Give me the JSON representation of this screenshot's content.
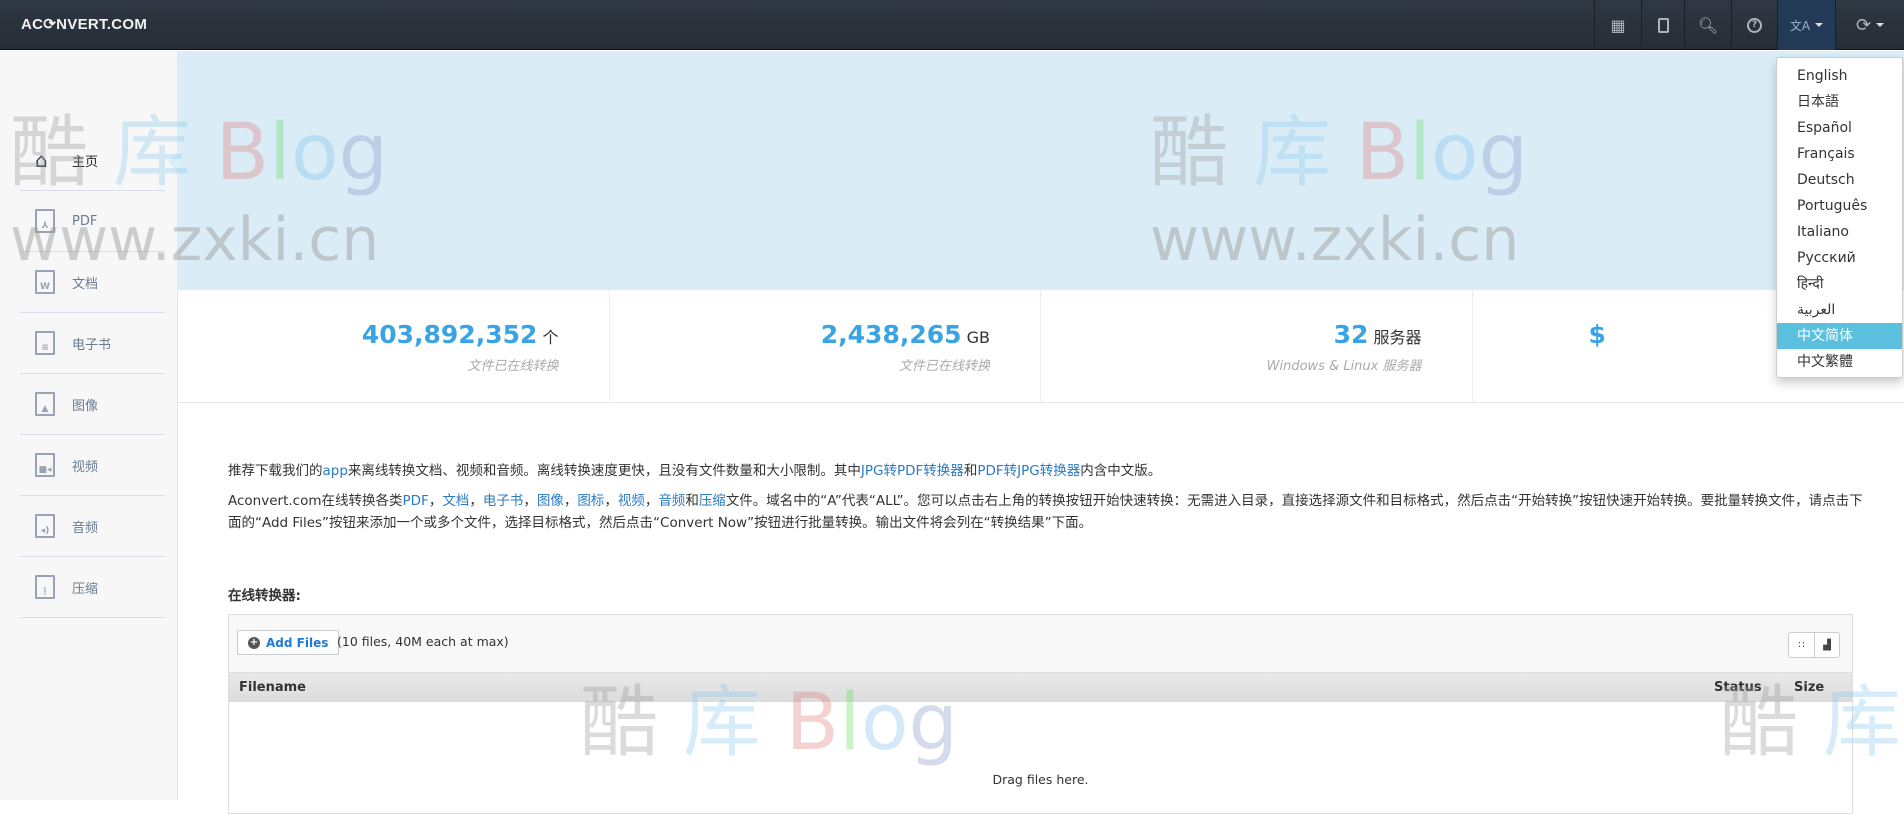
{
  "navbar": {
    "logo": "AC⟳NVERT.COM",
    "buttons": [
      {
        "icon": "grid-icon"
      },
      {
        "icon": "tablet-icon"
      },
      {
        "icon": "search-icon"
      },
      {
        "icon": "help-icon"
      },
      {
        "icon": "language-icon"
      },
      {
        "icon": "refresh-icon"
      }
    ]
  },
  "sidebar": {
    "items": [
      {
        "label": "主页",
        "icon": "home-icon"
      },
      {
        "label": "PDF",
        "icon": "pdf-file-icon"
      },
      {
        "label": "文档",
        "icon": "word-file-icon"
      },
      {
        "label": "电子书",
        "icon": "ebook-file-icon"
      },
      {
        "label": "图像",
        "icon": "image-file-icon"
      },
      {
        "label": "视频",
        "icon": "video-file-icon"
      },
      {
        "label": "音频",
        "icon": "audio-file-icon"
      },
      {
        "label": "压缩",
        "icon": "archive-file-icon"
      }
    ]
  },
  "stats": [
    {
      "value": "403,892,352",
      "unit": "个",
      "sub": "文件已在线转换"
    },
    {
      "value": "2,438,265",
      "unit": "GB",
      "sub": "文件已在线转换"
    },
    {
      "value": "32",
      "unit": "服务器",
      "sub": "Windows & Linux 服务器"
    },
    {
      "value": "$",
      "unit": "",
      "sub": ""
    }
  ],
  "intro": {
    "p1": [
      "推荐下载我们的",
      "app",
      "来离线转换文档、视频和音频。离线转换速度更快，且没有文件数量和大小限制。其中",
      "JPG转PDF转换器",
      "和",
      "PDF转JPG转换器",
      "内含中文版。"
    ],
    "p2": [
      "Aconvert.com在线转换各类",
      "PDF",
      "，",
      "文档",
      "，",
      "电子书",
      "，",
      "图像",
      "，",
      "图标",
      "，",
      "视频",
      "，",
      "音频",
      "和",
      "压缩",
      "文件。域名中的“A”代表“ALL”。您可以点击右上角的转换按钮开始快速转换：无需进入目录，直接选择源文件和目标格式，然后点击“开始转换”按钮快速开始转换。要批量转换文件，请点击下面的“Add Files”按钮来添加一个或多个文件，选择目标格式，然后点击“Convert Now”按钮进行批量转换。输出文件将会列在“转换结果”下面。"
    ]
  },
  "converter": {
    "heading": "在线转换器:",
    "add_files": "Add Files",
    "limit": "(10 files, 40M each at max)",
    "columns": [
      "Filename",
      "Status",
      "Size"
    ],
    "drag_text": "Drag files here."
  },
  "language_menu": {
    "items": [
      "English",
      "日本語",
      "Español",
      "Français",
      "Deutsch",
      "Português",
      "Italiano",
      "Русский",
      "हिन्दी",
      "العربية",
      "中文简体",
      "中文繁體"
    ],
    "selected": "中文简体"
  },
  "watermark": {
    "text": "酷库Blog",
    "url": "www.zxki.cn"
  },
  "colors": {
    "accent": "#3aa3e3",
    "link": "#2a7bc4",
    "selected": "#5bc0de",
    "navbar": "#2a313b"
  }
}
